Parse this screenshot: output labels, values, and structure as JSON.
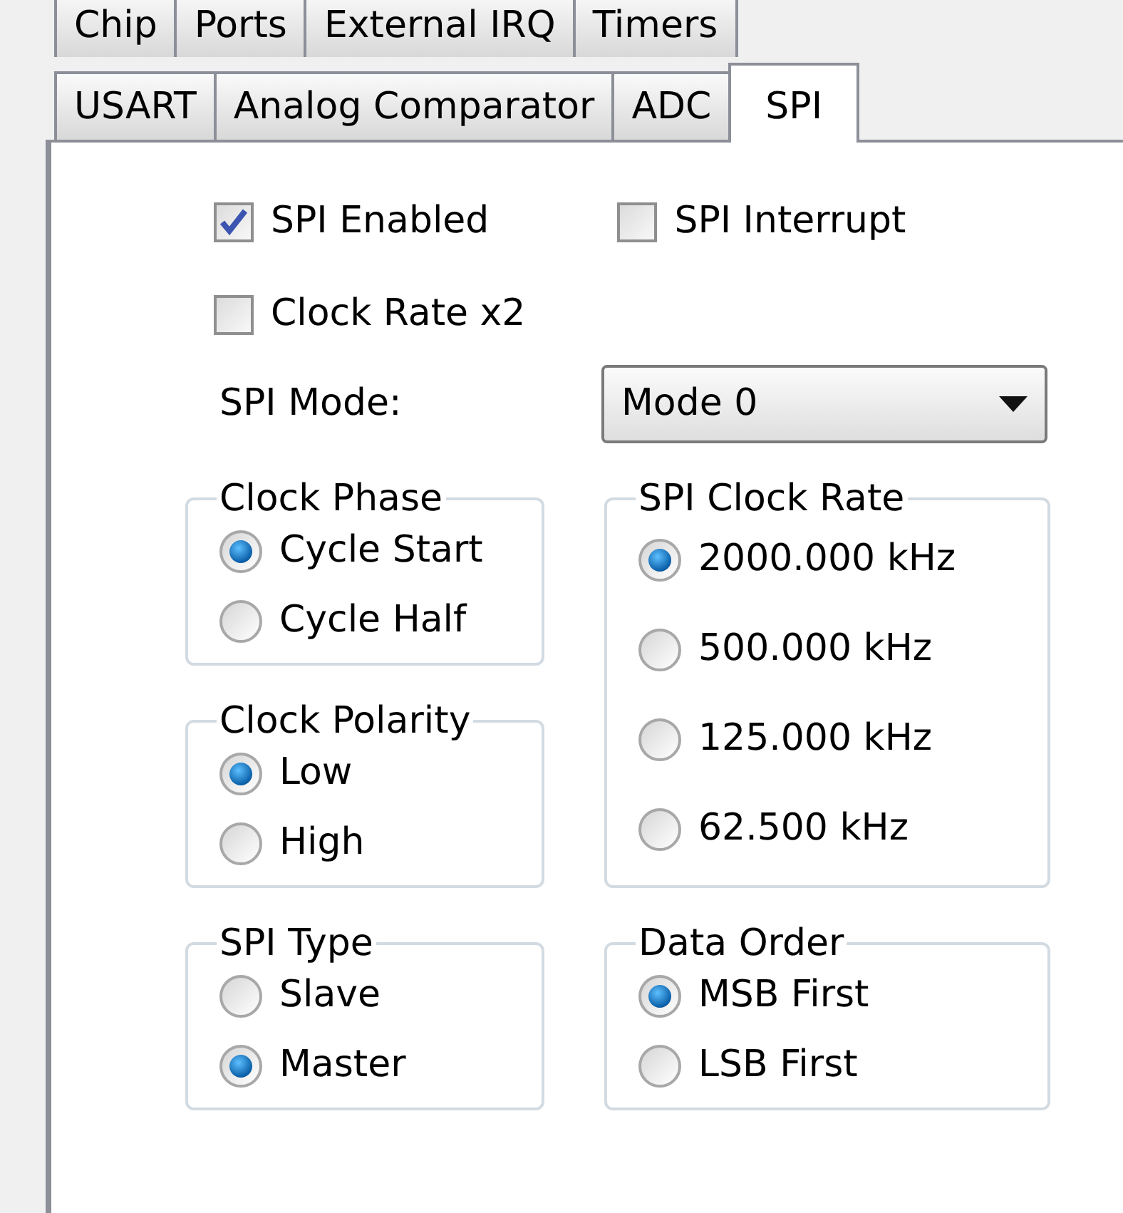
{
  "tabs_row_1": [
    {
      "label": "Chip",
      "selected": false
    },
    {
      "label": "Ports",
      "selected": false
    },
    {
      "label": "External IRQ",
      "selected": false
    },
    {
      "label": "Timers",
      "selected": false
    }
  ],
  "tabs_row_2": [
    {
      "label": "USART",
      "selected": false
    },
    {
      "label": "Analog Comparator",
      "selected": false
    },
    {
      "label": "ADC",
      "selected": false
    },
    {
      "label": "SPI",
      "selected": true
    }
  ],
  "checkboxes": [
    {
      "label": "SPI Enabled",
      "checked": true
    },
    {
      "label": "SPI Interrupt",
      "checked": false
    },
    {
      "label": "Clock Rate x2",
      "checked": false
    }
  ],
  "spi_mode": {
    "label": "SPI Mode:",
    "value": "Mode 0"
  },
  "groups": [
    {
      "title": "Clock Phase",
      "options": [
        {
          "label": "Cycle Start",
          "selected": true
        },
        {
          "label": "Cycle Half",
          "selected": false
        }
      ]
    },
    {
      "title": "SPI Clock Rate",
      "options": [
        {
          "label": "2000.000 kHz",
          "selected": true
        },
        {
          "label": "500.000 kHz",
          "selected": false
        },
        {
          "label": "125.000 kHz",
          "selected": false
        },
        {
          "label": "62.500 kHz",
          "selected": false
        }
      ]
    },
    {
      "title": "Clock Polarity",
      "options": [
        {
          "label": "Low",
          "selected": true
        },
        {
          "label": "High",
          "selected": false
        }
      ]
    },
    {
      "title": "SPI Type",
      "options": [
        {
          "label": "Slave",
          "selected": false
        },
        {
          "label": "Master",
          "selected": true
        }
      ]
    },
    {
      "title": "Data Order",
      "options": [
        {
          "label": "MSB First",
          "selected": true
        },
        {
          "label": "LSB First",
          "selected": false
        }
      ]
    }
  ]
}
